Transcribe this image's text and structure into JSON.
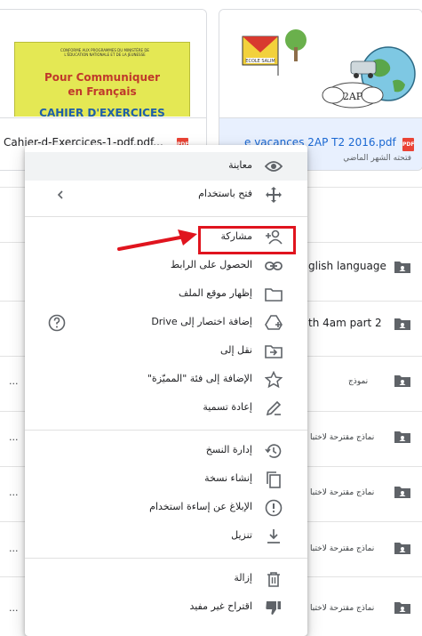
{
  "files": [
    {
      "name": "Cahier-d-Exercices-1-pdf.pdf...",
      "type": "pdf",
      "badge": "PDF",
      "cover": {
        "header": "CONFORME AUX PROGRAMMES DU MINISTÈRE DE L'ÉDUCATION NATIONALE ET DE LA JEUNESSE",
        "line1": "Pour Communiquer",
        "line2": "en Français",
        "line3": "CAHIER D'EXERCICES"
      }
    },
    {
      "name": "e vacances 2AP T2 2016.pdf",
      "type": "pdf",
      "badge": "PDF",
      "subtitle": "فتحته الشهر الماضي",
      "cover": {
        "label": "2AP",
        "school_sign": "ECOLE SALIM"
      }
    }
  ],
  "list": {
    "rows": [
      {
        "text": "glish language",
        "icon": "shared-folder-icon"
      },
      {
        "text": "th 4am part 2",
        "icon": "shared-folder-icon"
      },
      {
        "text": "نموذج",
        "prefix": "...",
        "icon": "shared-folder-icon"
      },
      {
        "text": "نماذج مقترحة لاختبا",
        "prefix": "...",
        "icon": "shared-folder-icon"
      },
      {
        "text": "نماذج مقترحة لاختبا",
        "prefix": "...",
        "icon": "shared-folder-icon"
      },
      {
        "text": "نماذج مقترحة لاختبا",
        "prefix": "...",
        "icon": "shared-folder-icon"
      },
      {
        "text": "نماذج مقترحة لاختبا",
        "prefix": "...",
        "icon": "shared-folder-icon"
      }
    ]
  },
  "menu": {
    "items": [
      {
        "label": "معاينة",
        "icon": "eye-icon"
      },
      {
        "label": "فتح باستخدام",
        "icon": "open-with-icon",
        "aux": "chevron-left-icon"
      },
      {
        "label": "مشاركة",
        "icon": "add-person-icon"
      },
      {
        "label": "الحصول على الرابط",
        "icon": "link-icon"
      },
      {
        "label": "إظهار موقع الملف",
        "icon": "folder-icon"
      },
      {
        "label": "إضافة اختصار إلى Drive",
        "icon": "add-shortcut-icon",
        "aux": "help-icon"
      },
      {
        "label": "نقل إلى",
        "icon": "move-to-icon"
      },
      {
        "label": "الإضافة إلى فئة \"المميّزة\"",
        "icon": "star-icon"
      },
      {
        "label": "إعادة تسمية",
        "icon": "pencil-icon"
      },
      {
        "label": "إدارة النسخ",
        "icon": "history-icon"
      },
      {
        "label": "إنشاء نسخة",
        "icon": "copy-icon"
      },
      {
        "label": "الإبلاغ عن إساءة استخدام",
        "icon": "report-icon"
      },
      {
        "label": "تنزيل",
        "icon": "download-icon"
      },
      {
        "label": "إزالة",
        "icon": "trash-icon"
      },
      {
        "label": "اقتراح غير مفيد",
        "icon": "thumbs-down-icon"
      }
    ]
  },
  "annotation": {
    "color": "#e0141e"
  },
  "colors": {
    "selected_bg": "#e8f0fe",
    "accent": "#1967d2",
    "pdf": "#ea4335"
  }
}
